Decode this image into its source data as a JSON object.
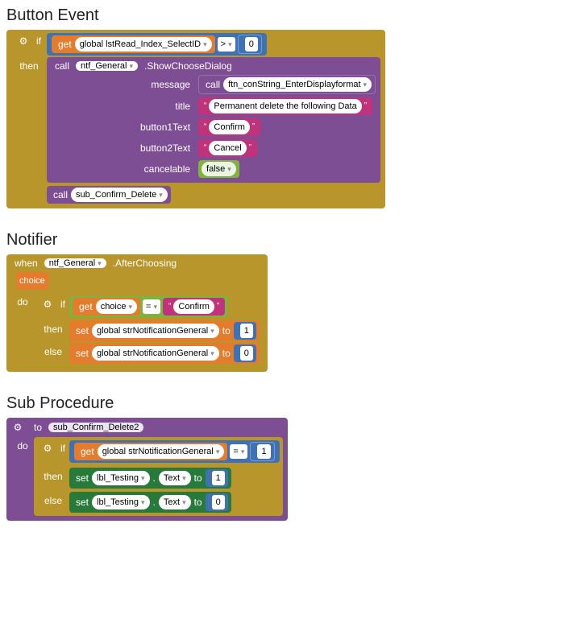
{
  "sections": {
    "s1": {
      "title": "Button Event"
    },
    "s2": {
      "title": "Notifier"
    },
    "s3": {
      "title": "Sub Procedure"
    }
  },
  "kw": {
    "if": "if",
    "then": "then",
    "else": "else",
    "do": "do",
    "call": "call",
    "get": "get",
    "set": "set",
    "to": "to",
    "when": "when"
  },
  "s1": {
    "get_var": "global lstRead_Index_SelectID",
    "op_gt": ">",
    "zero": "0",
    "call_obj": "ntf_General",
    "call_method": ".ShowChooseDialog",
    "args": {
      "message_lbl": "message",
      "message_call": "ftn_conString_EnterDisplayformat",
      "title_lbl": "title",
      "title_val": "Permanent delete the following Data",
      "b1_lbl": "button1Text",
      "b1_val": "Confirm",
      "b2_lbl": "button2Text",
      "b2_val": "Cancel",
      "cancel_lbl": "cancelable",
      "cancel_val": "false"
    },
    "call_sub": "sub_Confirm_Delete"
  },
  "s2": {
    "when_obj": "ntf_General",
    "when_evt": ".AfterChoosing",
    "param": "choice",
    "get_var": "choice",
    "op_eq": "=",
    "cmp_val": "Confirm",
    "set_var": "global strNotificationGeneral",
    "to1": "1",
    "to0": "0"
  },
  "s3": {
    "proc_name": "sub_Confirm_Delete2",
    "get_var": "global strNotificationGeneral",
    "op_eq": "=",
    "one": "1",
    "zero": "0",
    "set_obj": "lbl_Testing",
    "set_prop": "Text"
  }
}
